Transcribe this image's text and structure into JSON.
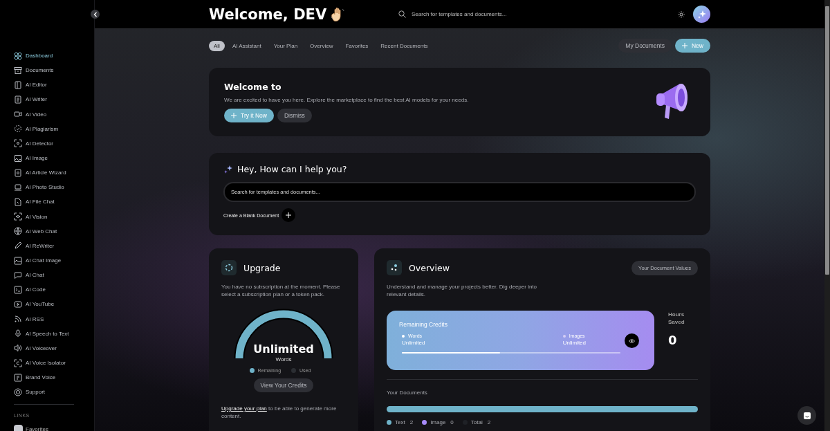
{
  "sidebar": {
    "items": [
      {
        "label": "Dashboard",
        "selected": true
      },
      {
        "label": "Documents",
        "selected": false
      },
      {
        "label": "AI Editor",
        "selected": false
      },
      {
        "label": "AI Writer",
        "selected": false
      },
      {
        "label": "AI Video",
        "selected": false
      },
      {
        "label": "AI Plagiarism",
        "selected": false
      },
      {
        "label": "AI Detector",
        "selected": false
      },
      {
        "label": "AI Image",
        "selected": false
      },
      {
        "label": "AI Article Wizard",
        "selected": false
      },
      {
        "label": "AI Photo Studio",
        "selected": false
      },
      {
        "label": "AI File Chat",
        "selected": false
      },
      {
        "label": "AI Vision",
        "selected": false
      },
      {
        "label": "AI Web Chat",
        "selected": false
      },
      {
        "label": "AI ReWriter",
        "selected": false
      },
      {
        "label": "AI Chat Image",
        "selected": false
      },
      {
        "label": "AI Chat",
        "selected": false
      },
      {
        "label": "AI Code",
        "selected": false
      },
      {
        "label": "AI YouTube",
        "selected": false
      },
      {
        "label": "AI RSS",
        "selected": false
      },
      {
        "label": "AI Speech to Text",
        "selected": false
      },
      {
        "label": "AI Voiceover",
        "selected": false
      },
      {
        "label": "AI Voice Isolator",
        "selected": false
      },
      {
        "label": "Brand Voice",
        "selected": false
      },
      {
        "label": "Support",
        "selected": false
      }
    ],
    "section_label": "LINKS",
    "links": [
      {
        "label": "Favorites"
      }
    ]
  },
  "header": {
    "title": "Welcome, DEV",
    "search": {
      "placeholder": "Search for templates and documents..."
    }
  },
  "filter_tabs": [
    {
      "label": "All",
      "selected": true
    },
    {
      "label": "AI Assistant",
      "selected": false
    },
    {
      "label": "Your Plan",
      "selected": false
    },
    {
      "label": "Overview",
      "selected": false
    },
    {
      "label": "Favorites",
      "selected": false
    },
    {
      "label": "Recent Documents",
      "selected": false
    }
  ],
  "actions": [
    {
      "label": "My Documents",
      "kind": "secondary"
    },
    {
      "label": "New",
      "kind": "primary"
    }
  ],
  "welcome_card": {
    "title": "Welcome to",
    "text": "We are excited to have you here. Explore the marketplace to find the best AI models for your needs.",
    "buttons": [
      {
        "label": "Try it Now",
        "kind": "primary"
      },
      {
        "label": "Dismiss",
        "kind": "secondary"
      }
    ]
  },
  "assistant_card": {
    "title": "Hey, How can I help you?",
    "search": {
      "placeholder": "Search for templates and documents..."
    },
    "create_label": "Create a Blank Document"
  },
  "upgrade_card": {
    "title": "Upgrade",
    "text": "You have no subscription at the moment. Please select a subscription plan or a token pack.",
    "gauge": {
      "value": "Unlimited",
      "unit": "Words"
    },
    "legend": [
      {
        "label": "Remaining",
        "color": "#6fb3c9"
      },
      {
        "label": "Used",
        "color": "#2b2e33"
      }
    ],
    "button": "View Your Credits",
    "footer_link": "Upgrade your plan",
    "footer_text": " to be able to generate more content."
  },
  "overview_card": {
    "title": "Overview",
    "button": "Your Document Values",
    "text": "Understand and manage your projects better. Dig deeper into relevant details.",
    "credits": {
      "title": "Remaining Credits",
      "items": [
        {
          "label": "Words",
          "value": "Unlimited",
          "color": "#ffffff"
        },
        {
          "label": "Images",
          "value": "Unlimited",
          "color": "#d4cdf5"
        }
      ],
      "level": 0.45
    },
    "hours": {
      "label": "Hours Saved",
      "value": "0"
    },
    "documents": {
      "title": "Your Documents",
      "legend": [
        {
          "label": "Text",
          "count": "2",
          "color": "#6fb3c9"
        },
        {
          "label": "Image",
          "count": "0",
          "color": "#a78bfa"
        },
        {
          "label": "Total",
          "count": "2",
          "color": "#1f2126"
        }
      ]
    }
  }
}
